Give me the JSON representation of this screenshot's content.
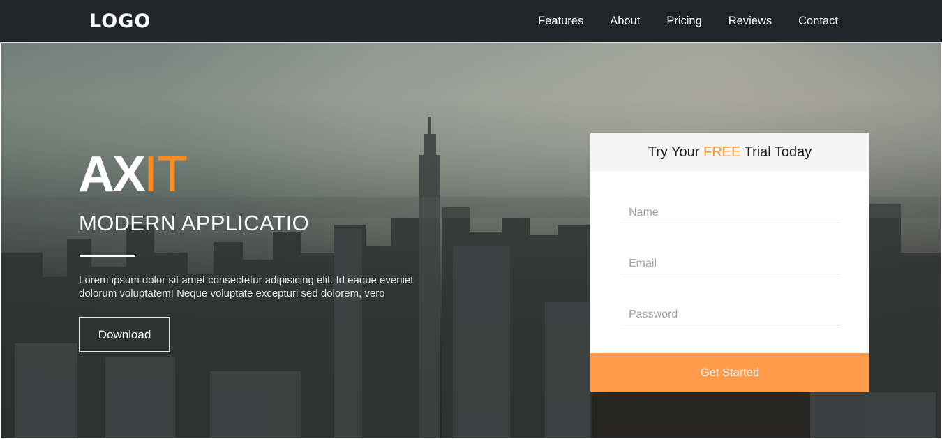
{
  "nav": {
    "logo": "LOGO",
    "links": [
      "Features",
      "About",
      "Pricing",
      "Reviews",
      "Contact"
    ]
  },
  "hero": {
    "brand_main": "AX",
    "brand_accent": "IT",
    "tagline": "MODERN APPLICATIO",
    "lead": "Lorem ipsum dolor sit amet consectetur adipisicing elit. Id eaque eveniet dolorum voluptatem! Neque voluptate excepturi sed dolorem, vero",
    "download_label": "Download"
  },
  "form": {
    "title_before": "Try Your ",
    "title_highlight": "FREE",
    "title_after": " Trial Today",
    "name_placeholder": "Name",
    "email_placeholder": "Email",
    "password_placeholder": "Password",
    "submit_label": "Get Started"
  },
  "colors": {
    "navbar": "#212429",
    "accent": "#ff8c1a",
    "button": "#ff9b4a"
  }
}
